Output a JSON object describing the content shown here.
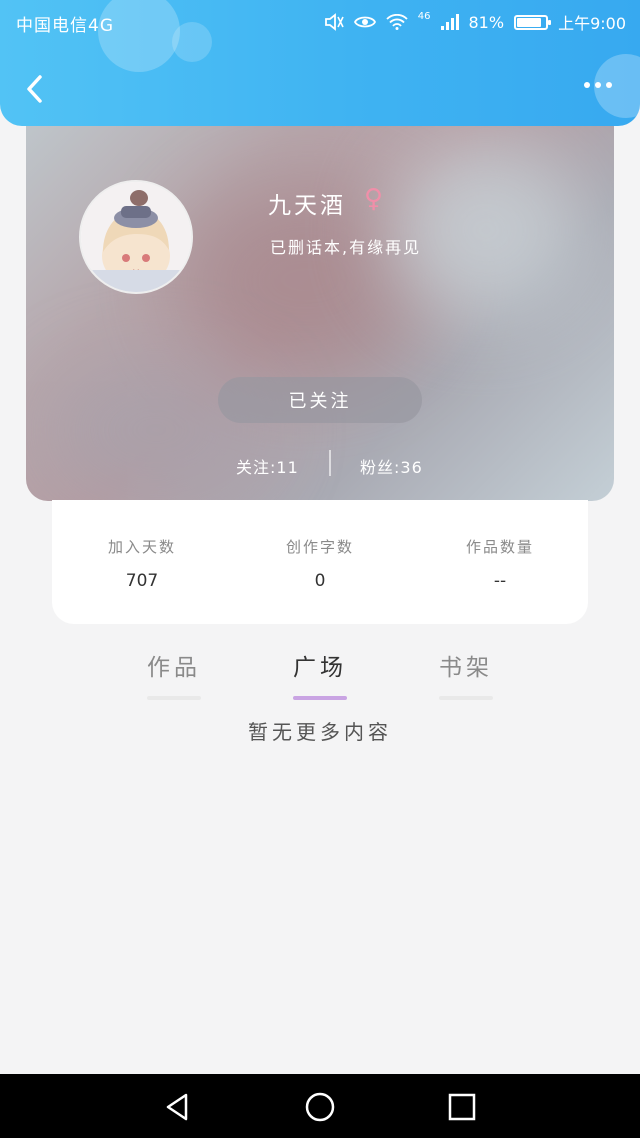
{
  "status_bar": {
    "carrier": "中国电信4G",
    "network": "46",
    "battery": "81%",
    "battery_level": 0.81,
    "time": "上午9:00"
  },
  "header": {
    "back_icon": "chevron-left-icon",
    "more_icon": "more-dots-icon"
  },
  "profile": {
    "name": "九天酒",
    "gender_symbol": "♀",
    "bio": "已删话本,有缘再见",
    "follow_button": "已关注",
    "following": "关注:11",
    "fans": "粉丝:36"
  },
  "stats": [
    {
      "label": "加入天数",
      "value": "707"
    },
    {
      "label": "创作字数",
      "value": "0"
    },
    {
      "label": "作品数量",
      "value": "--"
    }
  ],
  "tabs": [
    {
      "label": "作品",
      "active": false
    },
    {
      "label": "广场",
      "active": true
    },
    {
      "label": "书架",
      "active": false
    }
  ],
  "empty_message": "暂无更多内容",
  "colors": {
    "header_blue": "#3fb3f2",
    "tab_indicator": "#c9a4e3",
    "gender_pink": "#f08fa9"
  }
}
